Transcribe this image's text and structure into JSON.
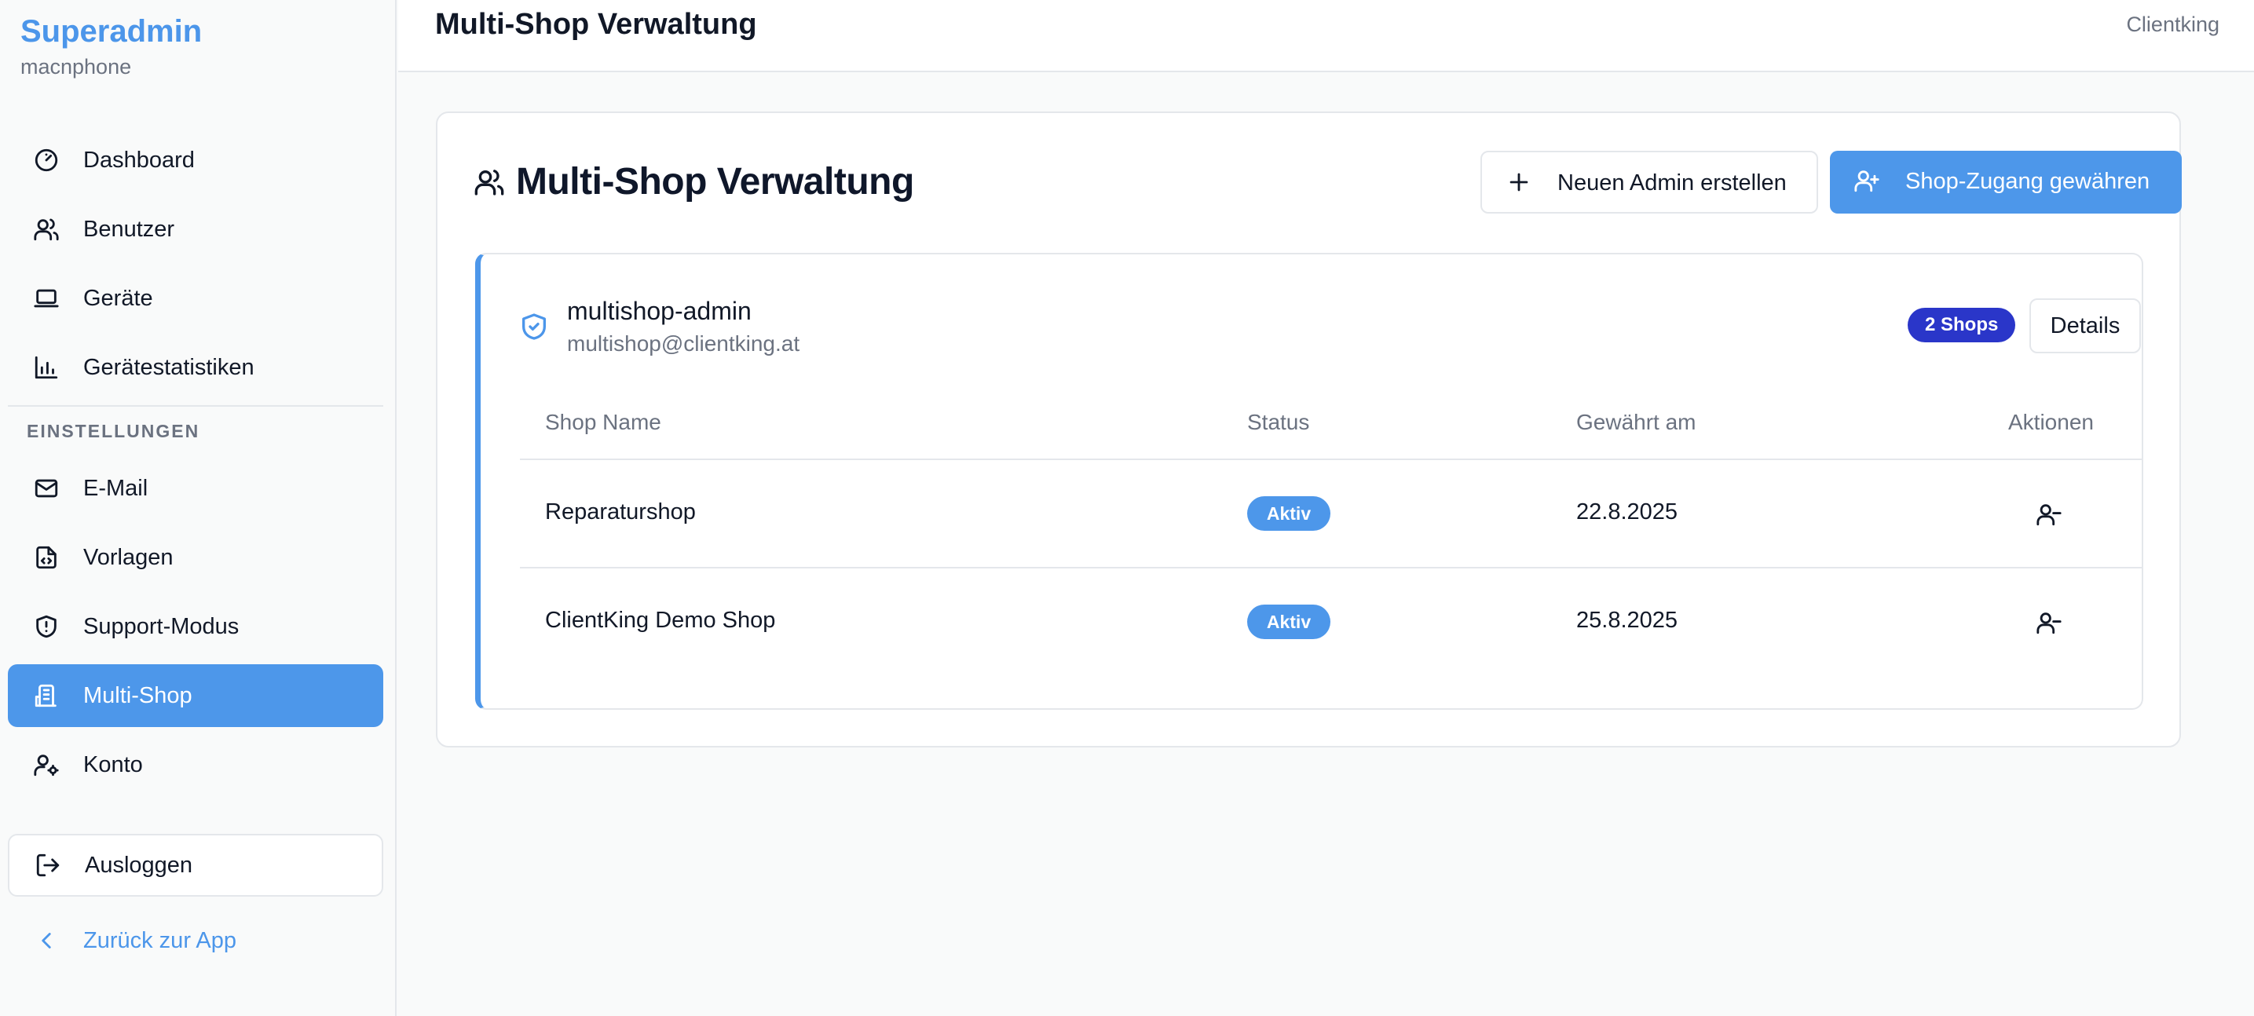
{
  "sidebar": {
    "brand_title": "Superadmin",
    "brand_subtitle": "macnphone",
    "items_top": [
      {
        "label": "Dashboard",
        "icon": "gauge-icon"
      },
      {
        "label": "Benutzer",
        "icon": "users-icon"
      },
      {
        "label": "Geräte",
        "icon": "laptop-icon"
      },
      {
        "label": "Gerätestatistiken",
        "icon": "bar-chart-icon"
      }
    ],
    "section_label": "EINSTELLUNGEN",
    "items_settings": [
      {
        "label": "E-Mail",
        "icon": "mail-icon"
      },
      {
        "label": "Vorlagen",
        "icon": "file-code-icon"
      },
      {
        "label": "Support-Modus",
        "icon": "shield-alert-icon"
      },
      {
        "label": "Multi-Shop",
        "icon": "building-icon",
        "active": true
      },
      {
        "label": "Konto",
        "icon": "user-cog-icon"
      }
    ],
    "logout_label": "Ausloggen",
    "back_label": "Zurück zur App"
  },
  "header": {
    "title": "Multi-Shop Verwaltung",
    "right_text": "Clientking"
  },
  "main": {
    "title": "Multi-Shop Verwaltung",
    "new_admin_label": "Neuen Admin erstellen",
    "grant_access_label": "Shop-Zugang gewähren",
    "admin": {
      "name": "multishop-admin",
      "email": "multishop@clientking.at",
      "shops_badge": "2 Shops",
      "details_label": "Details"
    },
    "table": {
      "headers": [
        "Shop Name",
        "Status",
        "Gewährt am",
        "Aktionen"
      ],
      "rows": [
        {
          "shop": "Reparaturshop",
          "status": "Aktiv",
          "granted": "22.8.2025"
        },
        {
          "shop": "ClientKing Demo Shop",
          "status": "Aktiv",
          "granted": "25.8.2025"
        }
      ]
    }
  },
  "colors": {
    "accent": "#4d97ea",
    "badge_dark": "#2a36c9",
    "text_muted": "#6b7280",
    "border": "#e4e7eb"
  }
}
